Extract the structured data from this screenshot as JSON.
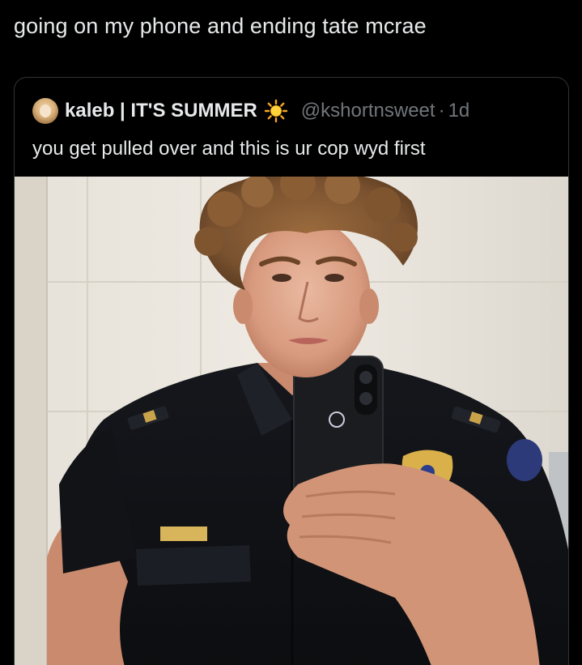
{
  "post": {
    "text": "going on my phone and ending tate mcrae"
  },
  "quoted_tweet": {
    "display_name": "kaleb | IT'S SUMMER",
    "emoji": "sun-icon",
    "handle": "@kshortnsweet",
    "separator": "·",
    "time": "1d",
    "text": "you get pulled over and this is ur cop wyd first"
  },
  "colors": {
    "background": "#000000",
    "primary_text": "#e7e9ea",
    "secondary_text": "#71767b",
    "border": "#2f3336"
  }
}
